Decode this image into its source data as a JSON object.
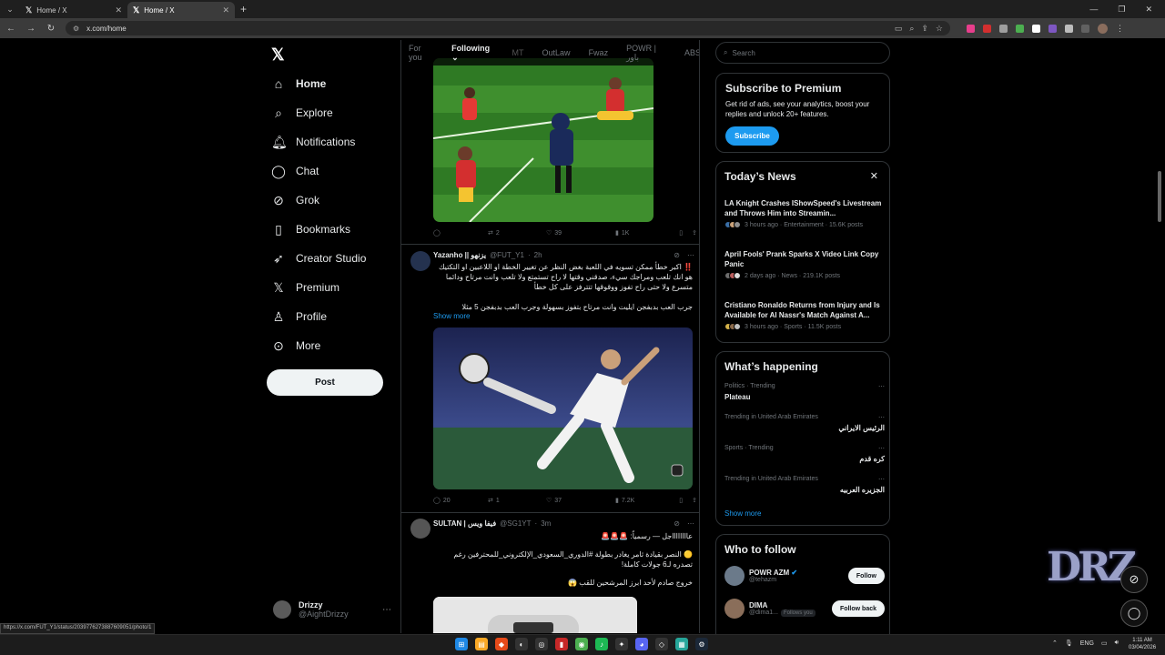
{
  "browser": {
    "tabs": [
      {
        "title": "Home / X",
        "active": false
      },
      {
        "title": "Home / X",
        "active": true
      }
    ],
    "url": "x.com/home",
    "status_link": "https://x.com/FUT_Y1/status/2039776273887609051/photo/1"
  },
  "nav": {
    "items": [
      {
        "label": "Home",
        "icon": "home-icon"
      },
      {
        "label": "Explore",
        "icon": "search-icon"
      },
      {
        "label": "Notifications",
        "icon": "bell-icon"
      },
      {
        "label": "Chat",
        "icon": "chat-icon"
      },
      {
        "label": "Grok",
        "icon": "grok-icon"
      },
      {
        "label": "Bookmarks",
        "icon": "bookmark-icon"
      },
      {
        "label": "Creator Studio",
        "icon": "rocket-icon"
      },
      {
        "label": "Premium",
        "icon": "x-icon"
      },
      {
        "label": "Profile",
        "icon": "person-icon"
      },
      {
        "label": "More",
        "icon": "more-circle-icon"
      }
    ],
    "post_label": "Post",
    "account": {
      "name": "Drizzy",
      "handle": "@AightDrizzy"
    }
  },
  "feed": {
    "tabs": [
      "For you",
      "Following",
      "MT",
      "OutLaw",
      "Fwaz",
      "POWR | باور",
      "ABS"
    ],
    "tweets": [
      {
        "actions": {
          "replies": "",
          "reposts": "2",
          "likes": "39",
          "views": "1K"
        }
      },
      {
        "name": "Yazanho || يزنهو",
        "handle": "@FUT_Y1",
        "time": "2h",
        "text_lines": [
          "‼️ اكبر خطأ ممكن تسويه في اللعبة بغض النظر عن تغيير الخطة او اللاعبين او التكتيك",
          "هو انك تلعب ومراجك سيء، صدقني وقتها لا راح تستمتع ولا تلعب وانت مرتاح ودائما",
          "متسرع ولا حتى راح تفوز ووقوقها تتترفز على كل خطأ",
          "",
          "جرب العب بدبفجن ايليت وانت مرتاح بتفوز بسهولة وجرب العب بدبفجن 5 مثلا"
        ],
        "show_more": "Show more",
        "actions": {
          "replies": "20",
          "reposts": "1",
          "likes": "37",
          "views": "7.2K"
        }
      },
      {
        "name": "SULTAN | فيفا ويس",
        "handle": "@SG1YT",
        "time": "3m",
        "text_lines": [
          "عااااااااجل — رسمياً: 🚨🚨🚨",
          "",
          "🟡 النصر بقيادة ثامر يغادر بطولة #الدوري_السعودي_الإلكتروني_للمحترفين رغم",
          "تصدره لـ6 جولات كاملة!",
          "",
          "خروج صادم لأحد ابرز المرشحين للقب 😱"
        ]
      }
    ]
  },
  "right": {
    "search_placeholder": "Search",
    "premium": {
      "title": "Subscribe to Premium",
      "desc": "Get rid of ads, see your analytics, boost your replies and unlock 20+ features.",
      "button": "Subscribe"
    },
    "news": {
      "title": "Today’s News",
      "items": [
        {
          "title": "LA Knight Crashes IShowSpeed's Livestream and Throws Him into Streamin...",
          "meta": "3 hours ago · Entertainment · 15.6K posts"
        },
        {
          "title": "April Fools' Prank Sparks X Video Link Copy Panic",
          "meta": "2 days ago · News · 219.1K posts"
        },
        {
          "title": "Cristiano Ronaldo Returns from Injury and Is Available for Al Nassr's Match Against A...",
          "meta": "3 hours ago · Sports · 11.5K posts"
        }
      ]
    },
    "happening": {
      "title": "What’s happening",
      "trends": [
        {
          "category": "Politics · Trending",
          "name": "Plateau"
        },
        {
          "category": "Trending in United Arab Emirates",
          "name": "الرئيس الايراني"
        },
        {
          "category": "Sports · Trending",
          "name": "كره قدم"
        },
        {
          "category": "Trending in United Arab Emirates",
          "name": "الجزيره العربيه"
        }
      ],
      "show_more": "Show more"
    },
    "who_to_follow": {
      "title": "Who to follow",
      "users": [
        {
          "name": "POWR AZM",
          "handle": "@tehazm",
          "button": "Follow",
          "follows_you": ""
        },
        {
          "name": "DIMA",
          "handle": "@dima1...",
          "button": "Follow back",
          "follows_you": "Follows you"
        }
      ]
    }
  },
  "overlay": {
    "logo_text": "DRZ"
  },
  "system": {
    "lang": "ENG",
    "time": "1:11 AM",
    "date": "03/04/2026"
  }
}
